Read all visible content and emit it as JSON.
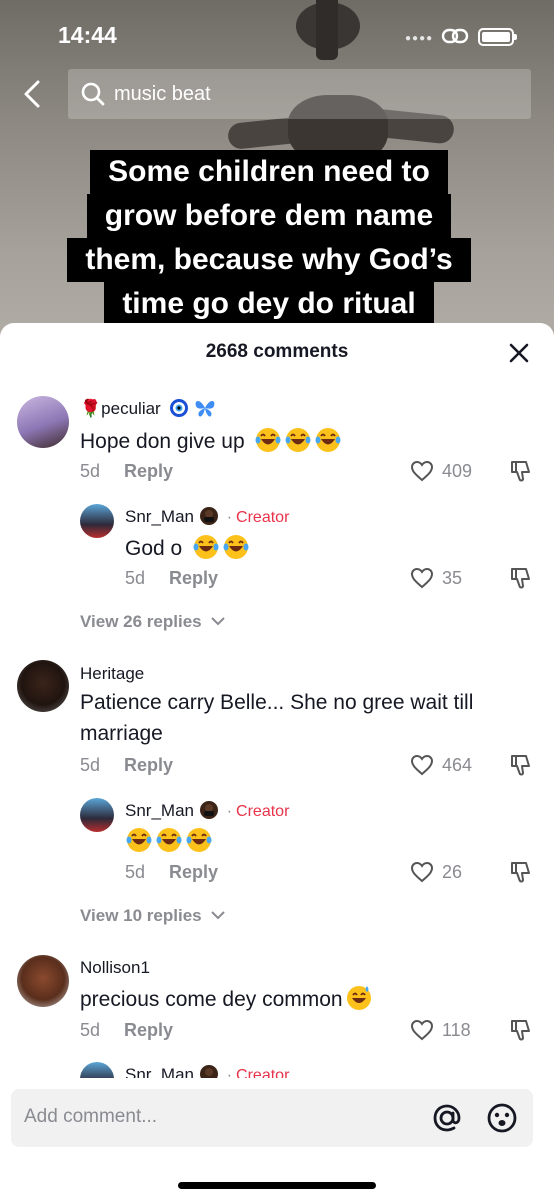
{
  "status_bar": {
    "time": "14:44"
  },
  "search": {
    "query": "music beat"
  },
  "caption": {
    "lines": [
      "Some children need to",
      "grow before dem name",
      "them, because why God’s",
      "time go dey do ritual"
    ]
  },
  "comments_panel": {
    "title": "2668 comments",
    "reply_label": "Reply",
    "creator_label": "Creator",
    "comments": [
      {
        "username": "peculiar",
        "text": "Hope don give up",
        "time": "5d",
        "likes": "409",
        "reply": {
          "username": "Snr_Man",
          "text": "God o",
          "time": "5d",
          "likes": "35"
        },
        "view_replies": "View 26 replies"
      },
      {
        "username": "Heritage",
        "text": "Patience carry Belle... She no gree wait till marriage",
        "time": "5d",
        "likes": "464",
        "reply": {
          "username": "Snr_Man",
          "text": "",
          "time": "5d",
          "likes": "26"
        },
        "view_replies": "View 10 replies"
      },
      {
        "username": "Nollison1",
        "text": "precious come dey common",
        "time": "5d",
        "likes": "118",
        "reply": {
          "username": "Snr_Man"
        }
      }
    ]
  },
  "composer": {
    "placeholder": "Add comment..."
  },
  "colors": {
    "creator": "#e8334a",
    "secondary_text": "#8a8b91",
    "primary_text": "#161823"
  }
}
